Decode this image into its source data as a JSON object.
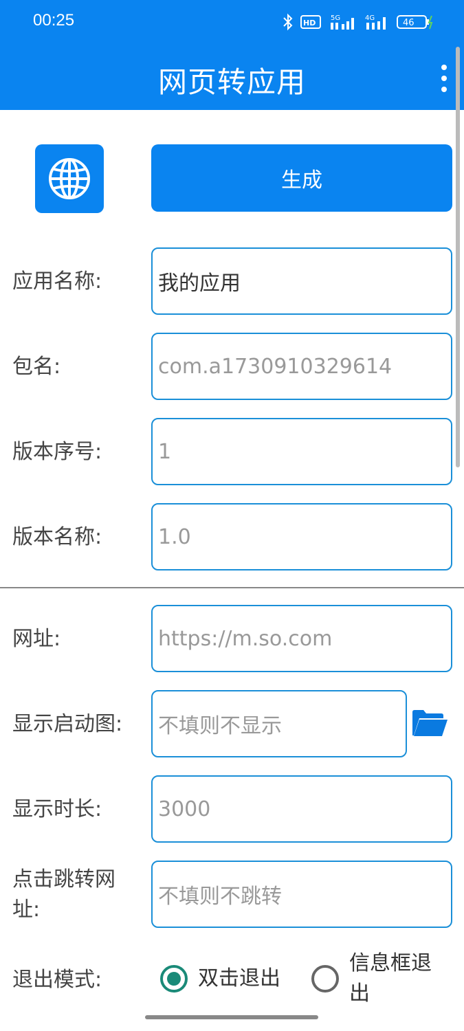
{
  "status": {
    "time": "00:25",
    "hd_label": "HD",
    "net1": "5G",
    "net2": "4G",
    "battery": "46",
    "bg_color": "#0a84f0"
  },
  "appbar": {
    "title": "网页转应用"
  },
  "toolbar": {
    "generate_label": "生成"
  },
  "form": {
    "app_name": {
      "label": "应用名称:",
      "value": "我的应用"
    },
    "package": {
      "label": "包名:",
      "placeholder": "com.a1730910329614"
    },
    "version_code": {
      "label": "版本序号:",
      "placeholder": "1"
    },
    "version_name": {
      "label": "版本名称:",
      "placeholder": "1.0"
    },
    "url": {
      "label": "网址:",
      "placeholder": "https://m.so.com"
    },
    "splash": {
      "label": "显示启动图:",
      "placeholder": "不填则不显示"
    },
    "duration": {
      "label": "显示时长:",
      "placeholder": "3000"
    },
    "jump_url": {
      "label_line1": "点击跳转网",
      "label_line2": "址:",
      "placeholder": "不填则不跳转"
    },
    "exit_mode": {
      "label": "退出模式:",
      "option1": "双击退出",
      "option2_line1": "信息框退",
      "option2_line2": "出",
      "selected": "双击退出"
    }
  },
  "icons": {
    "globe": "globe-icon",
    "folder": "folder-open-icon",
    "menu": "more-vert-icon"
  }
}
